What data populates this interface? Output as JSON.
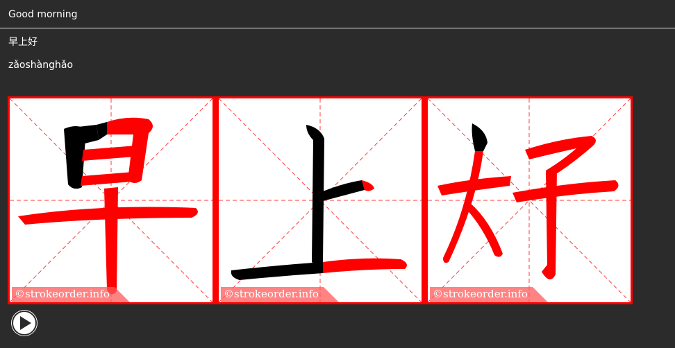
{
  "header": {
    "title": "Good morning"
  },
  "word": {
    "characters": "早上好",
    "pinyin": "zǎoshànghǎo"
  },
  "stroke_order": {
    "cells": [
      {
        "character": "早",
        "watermark": "©strokeorder.info"
      },
      {
        "character": "上",
        "watermark": "©strokeorder.info"
      },
      {
        "character": "好",
        "watermark": "©strokeorder.info"
      }
    ],
    "colors": {
      "border": "#ff0000",
      "stroke": "#ff0000",
      "done_stroke": "#000000",
      "guide": "#ff3b3b"
    }
  },
  "controls": {
    "play_icon": "play-icon"
  }
}
